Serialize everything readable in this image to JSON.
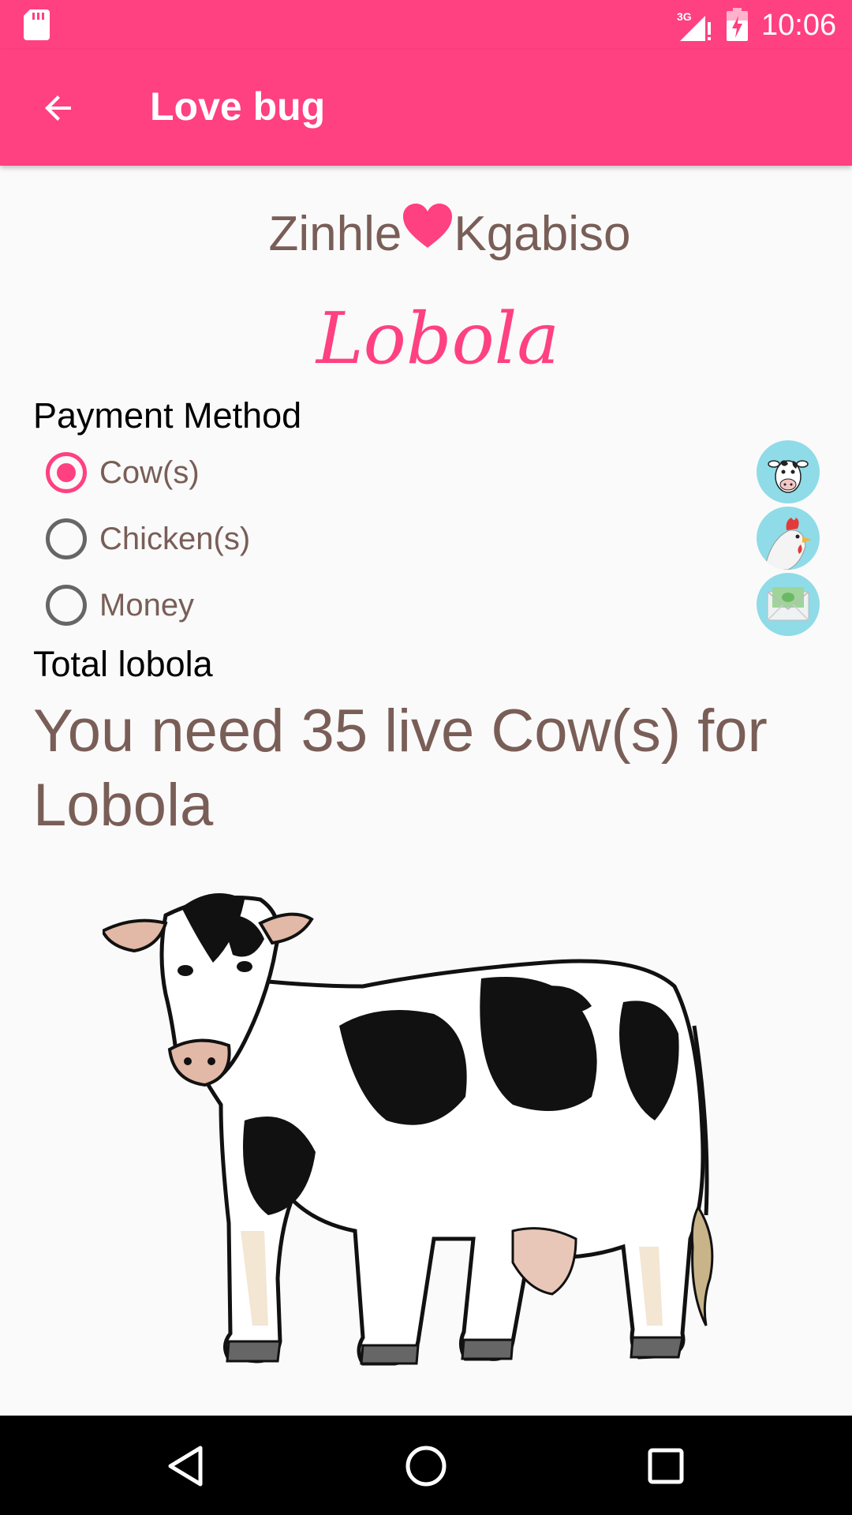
{
  "status_bar": {
    "time": "10:06",
    "network": "3G",
    "icons": [
      "sd-card-icon",
      "signal-icon",
      "battery-charging-icon"
    ]
  },
  "app_bar": {
    "title": "Love bug",
    "back_icon": "arrow-back-icon"
  },
  "couple": {
    "name_left": "Zinhle",
    "name_right": "Kgabiso",
    "separator_icon": "heart-icon"
  },
  "heading": "Lobola",
  "payment": {
    "label": "Payment Method",
    "options": [
      {
        "label": "Cow(s)",
        "selected": true,
        "icon": "cow-avatar-icon"
      },
      {
        "label": "Chicken(s)",
        "selected": false,
        "icon": "chicken-avatar-icon"
      },
      {
        "label": "Money",
        "selected": false,
        "icon": "money-envelope-icon"
      }
    ]
  },
  "total": {
    "label": "Total lobola",
    "result": "You need 35 live Cow(s) for Lobola"
  },
  "colors": {
    "accent": "#ff4081",
    "text_brown": "#795e57",
    "thumb_bg": "#8fdbe8"
  },
  "nav_bar": {
    "buttons": [
      "back-triangle-icon",
      "home-circle-icon",
      "recents-square-icon"
    ]
  }
}
